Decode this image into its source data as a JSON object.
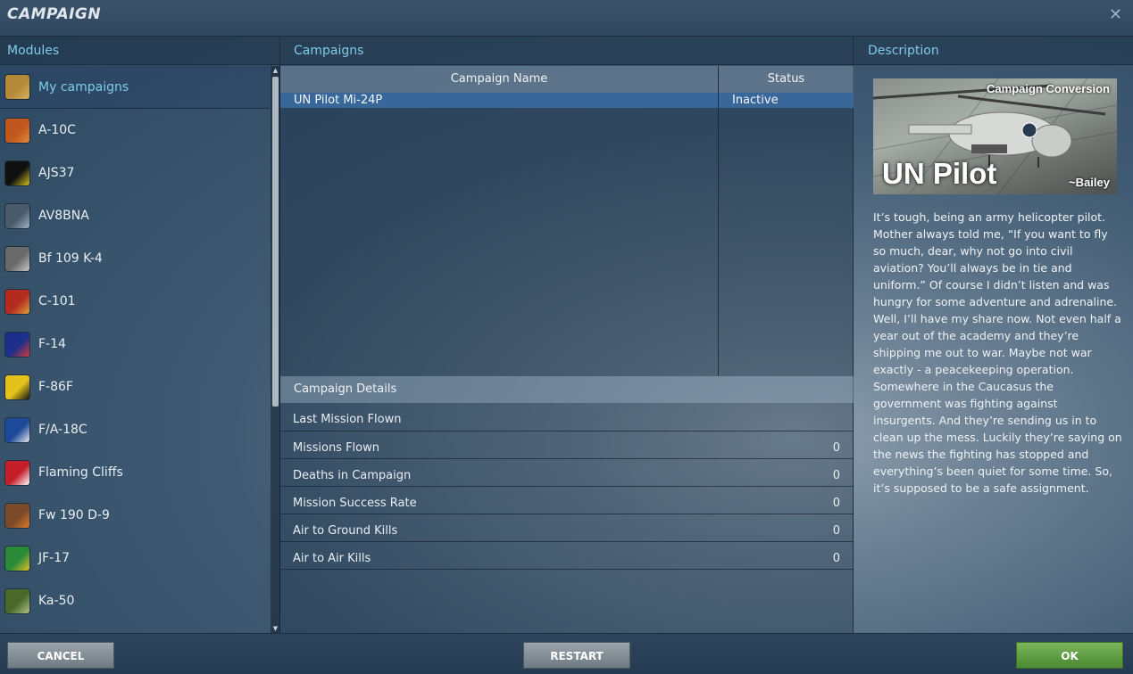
{
  "window": {
    "title": "CAMPAIGN",
    "close_glyph": "✕"
  },
  "columns": {
    "modules": "Modules",
    "campaigns": "Campaigns",
    "description": "Description"
  },
  "modules": [
    {
      "label": "My campaigns",
      "icon": "my-campaigns-icon",
      "colors": [
        "#b48a3a",
        "#d9b25c"
      ]
    },
    {
      "label": "A-10C",
      "icon": "a10c-icon",
      "colors": [
        "#c0571e",
        "#e08a3a"
      ]
    },
    {
      "label": "AJS37",
      "icon": "ajs37-icon",
      "colors": [
        "#101010",
        "#d6c21c"
      ]
    },
    {
      "label": "AV8BNA",
      "icon": "av8bna-icon",
      "colors": [
        "#4a5a6a",
        "#9fb0c0"
      ]
    },
    {
      "label": "Bf 109 K-4",
      "icon": "bf109-icon",
      "colors": [
        "#6a6a6a",
        "#c8c8c8"
      ]
    },
    {
      "label": "C-101",
      "icon": "c101-icon",
      "colors": [
        "#b32b1e",
        "#e0a23a"
      ]
    },
    {
      "label": "F-14",
      "icon": "f14-icon",
      "colors": [
        "#1c2f8a",
        "#d23a3a"
      ]
    },
    {
      "label": "F-86F",
      "icon": "f86f-icon",
      "colors": [
        "#e3c21c",
        "#101010"
      ]
    },
    {
      "label": "F/A-18C",
      "icon": "fa18c-icon",
      "colors": [
        "#1e4a9a",
        "#e8e8e8"
      ]
    },
    {
      "label": "Flaming Cliffs",
      "icon": "flaming-cliffs-icon",
      "colors": [
        "#c4202a",
        "#ffffff"
      ]
    },
    {
      "label": "Fw 190 D-9",
      "icon": "fw190-icon",
      "colors": [
        "#7a4a2a",
        "#e07a2a"
      ]
    },
    {
      "label": "JF-17",
      "icon": "jf17-icon",
      "colors": [
        "#2a8a3a",
        "#e0c21c"
      ]
    },
    {
      "label": "Ka-50",
      "icon": "ka50-icon",
      "colors": [
        "#4a6a2a",
        "#b0c08a"
      ]
    }
  ],
  "campaigns_table": {
    "headers": {
      "name": "Campaign Name",
      "status": "Status"
    },
    "rows": [
      {
        "name": "UN Pilot Mi-24P",
        "status": "Inactive"
      }
    ]
  },
  "details": {
    "title": "Campaign Details",
    "rows": [
      {
        "label": "Last Mission Flown",
        "value": ""
      },
      {
        "label": "Missions Flown",
        "value": "0"
      },
      {
        "label": "Deaths in Campaign",
        "value": "0"
      },
      {
        "label": "Mission Success Rate",
        "value": "0"
      },
      {
        "label": "Air to Ground Kills",
        "value": "0"
      },
      {
        "label": "Air to Air Kills",
        "value": "0"
      }
    ]
  },
  "description": {
    "image_tag": "Campaign Conversion",
    "image_title": "UN Pilot",
    "image_author": "~Bailey",
    "text": "It’s tough, being an army helicopter pilot. Mother always told me, “If you want to fly so much, dear, why not go into civil aviation? You’ll always be in tie and uniform.” Of course I didn’t listen and was hungry for some adventure and adrenaline. Well, I’ll have my share now. Not even half a year out of the academy and they’re shipping me out to war. Maybe not war exactly - a peacekeeping operation. Somewhere in the Caucasus the government was fighting against insurgents. And they’re sending us in to clean up the mess. Luckily they’re saying on the news the fighting has stopped and everything’s been quiet for some time. So, it’s supposed to be a safe assignment."
  },
  "buttons": {
    "cancel": "CANCEL",
    "restart": "RESTART",
    "ok": "OK"
  }
}
